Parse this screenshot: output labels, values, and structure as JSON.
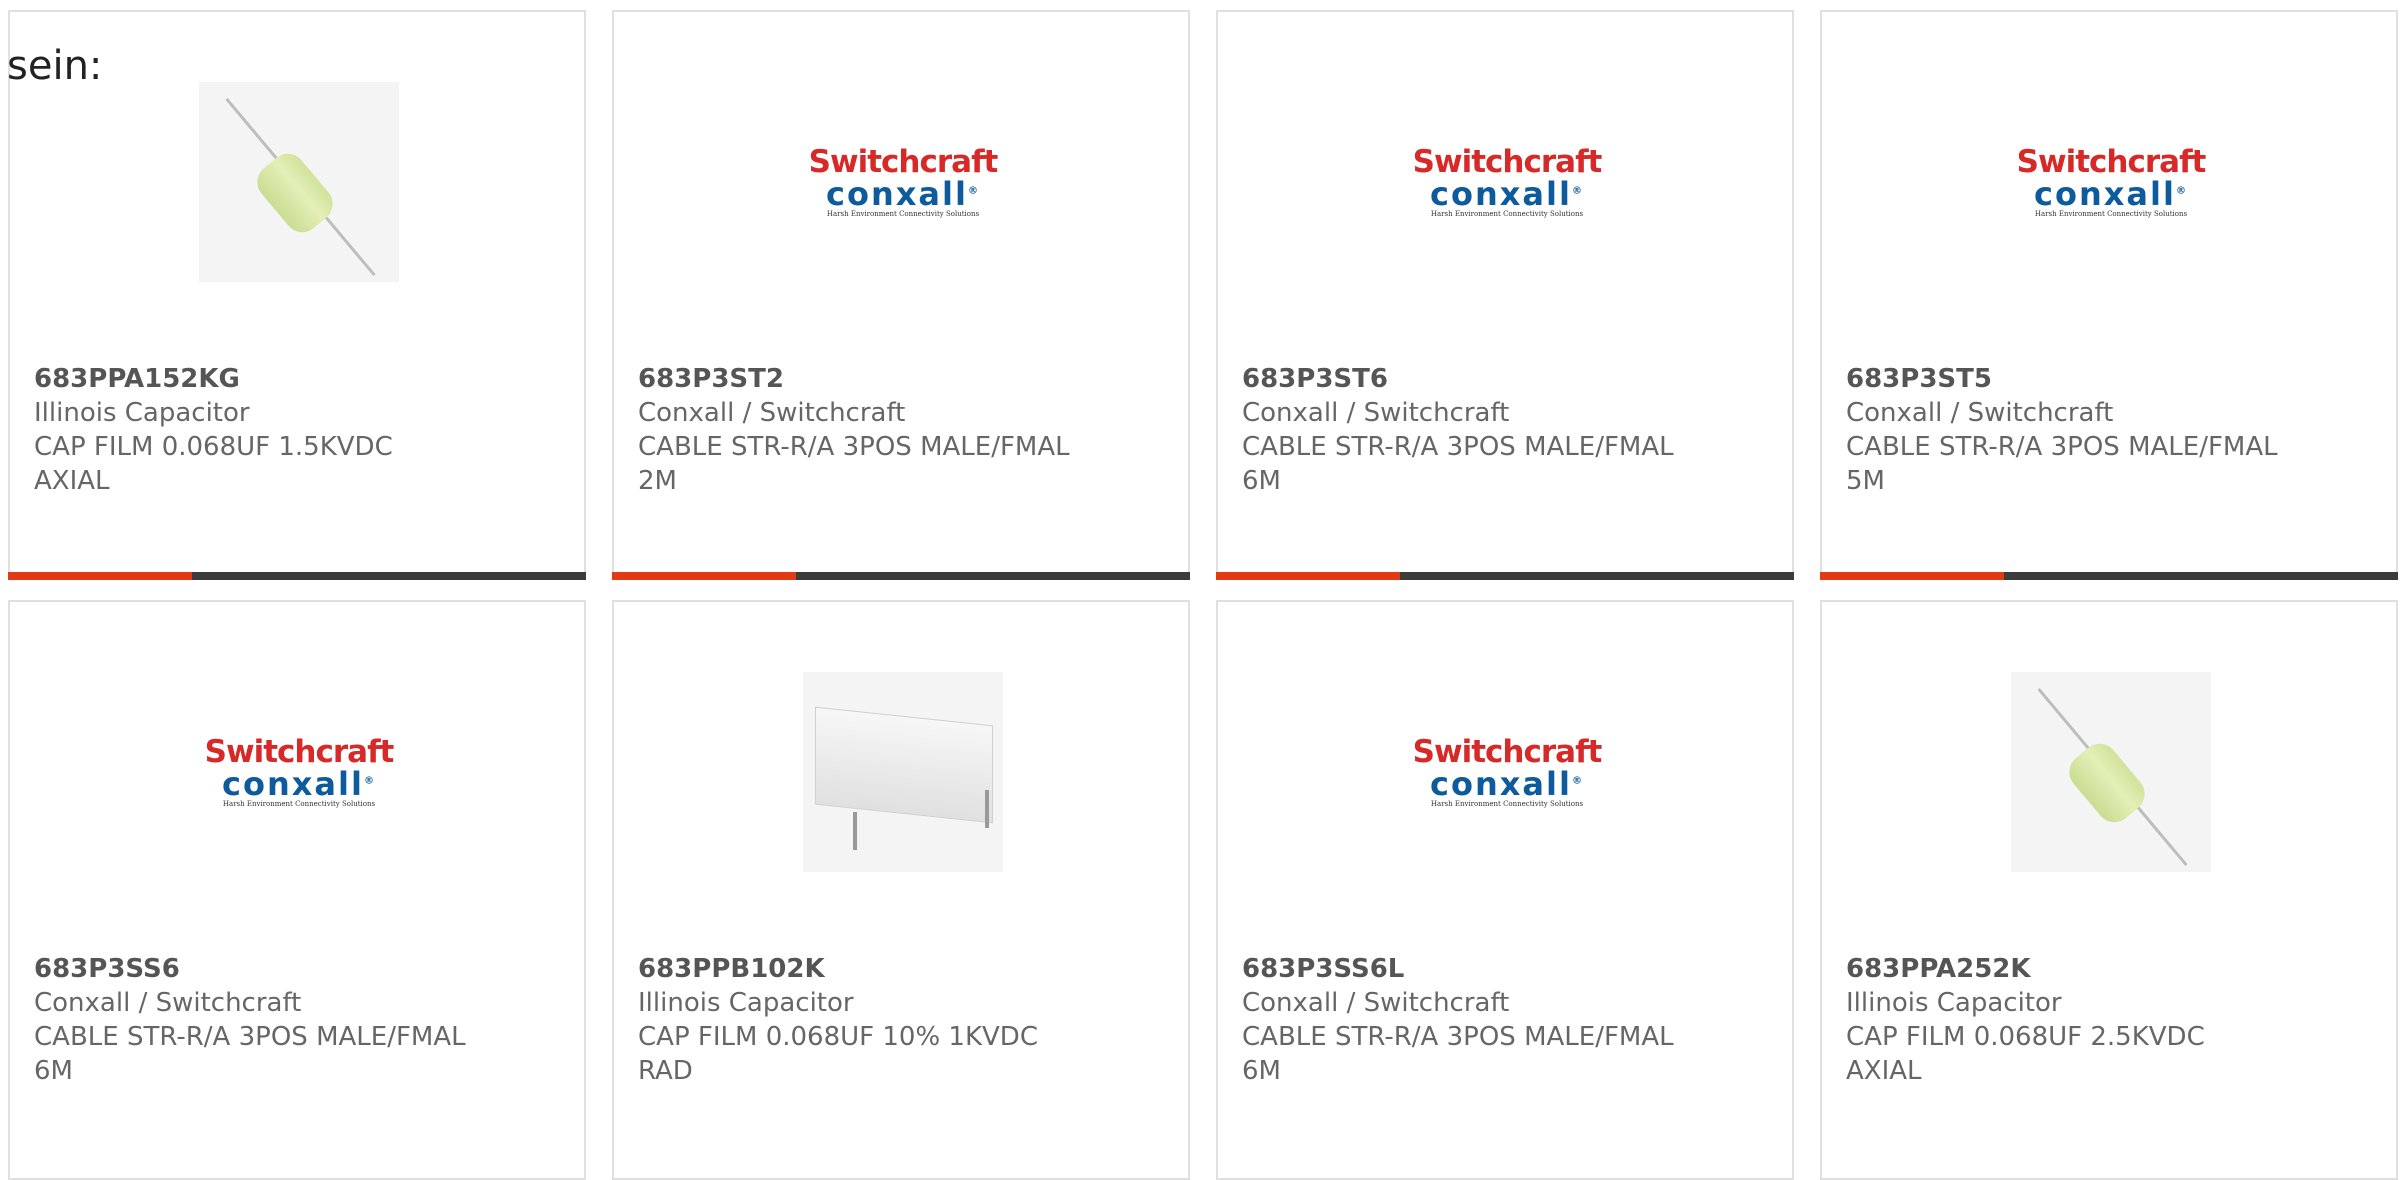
{
  "intro_text": "sein:",
  "colors": {
    "accent_red": "#e23a12",
    "accent_dark": "#3c3c3c",
    "logo_red": "#d72a28",
    "logo_blue": "#0d5a9c"
  },
  "logo": {
    "line1": "Switchcraft",
    "line2": "conxall",
    "tagline": "Harsh Environment Connectivity Solutions",
    "mark": "®"
  },
  "products": [
    {
      "part_number": "683PPA152KG",
      "manufacturer": "Illinois Capacitor",
      "desc_line1": "CAP FILM 0.068UF 1.5KVDC",
      "desc_line2": "AXIAL",
      "image": "axial-capacitor"
    },
    {
      "part_number": "683P3ST2",
      "manufacturer": "Conxall / Switchcraft",
      "desc_line1": "CABLE STR-R/A 3POS MALE/FMAL",
      "desc_line2": "2M",
      "image": "switchcraft-logo"
    },
    {
      "part_number": "683P3ST6",
      "manufacturer": "Conxall / Switchcraft",
      "desc_line1": "CABLE STR-R/A 3POS MALE/FMAL",
      "desc_line2": "6M",
      "image": "switchcraft-logo"
    },
    {
      "part_number": "683P3ST5",
      "manufacturer": "Conxall / Switchcraft",
      "desc_line1": "CABLE STR-R/A 3POS MALE/FMAL",
      "desc_line2": "5M",
      "image": "switchcraft-logo"
    },
    {
      "part_number": "683P3SS6",
      "manufacturer": "Conxall / Switchcraft",
      "desc_line1": "CABLE STR-R/A 3POS MALE/FMAL",
      "desc_line2": "6M",
      "image": "switchcraft-logo"
    },
    {
      "part_number": "683PPB102K",
      "manufacturer": "Illinois Capacitor",
      "desc_line1": "CAP FILM 0.068UF 10% 1KVDC",
      "desc_line2": "RAD",
      "image": "radial-capacitor"
    },
    {
      "part_number": "683P3SS6L",
      "manufacturer": "Conxall / Switchcraft",
      "desc_line1": "CABLE STR-R/A 3POS MALE/FMAL",
      "desc_line2": "6M",
      "image": "switchcraft-logo"
    },
    {
      "part_number": "683PPA252K",
      "manufacturer": "Illinois Capacitor",
      "desc_line1": "CAP FILM 0.068UF 2.5KVDC",
      "desc_line2": "AXIAL",
      "image": "axial-capacitor"
    }
  ]
}
